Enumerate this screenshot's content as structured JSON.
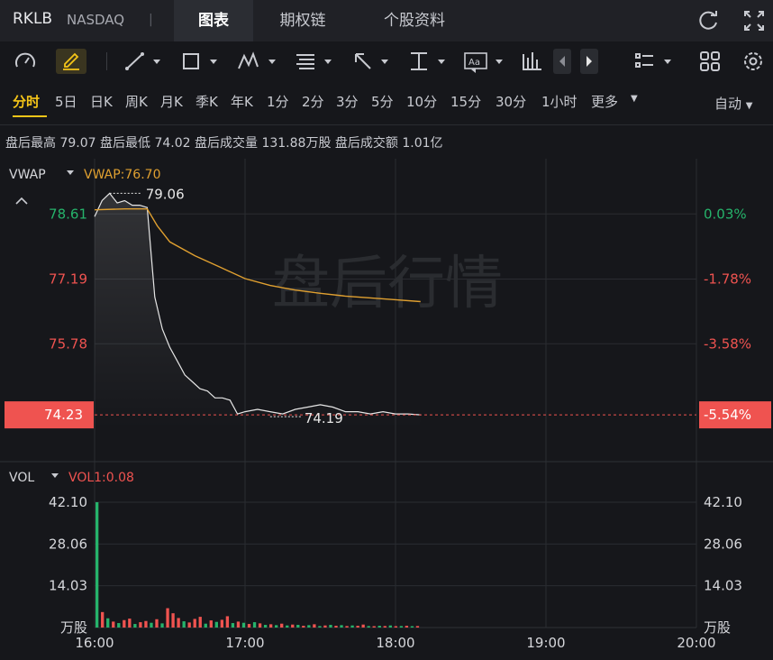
{
  "header": {
    "symbol": "RKLB",
    "exchange": "NASDAQ",
    "separator": "|",
    "tabs": [
      "图表",
      "期权链",
      "个股资料"
    ]
  },
  "periods": {
    "items": [
      "分时",
      "5日",
      "日K",
      "周K",
      "月K",
      "季K",
      "年K",
      "1分",
      "2分",
      "3分",
      "5分",
      "10分",
      "15分",
      "30分",
      "1小时",
      "更多"
    ],
    "selected": "分时",
    "auto_label": "自动"
  },
  "stats": {
    "high_label": "盘后最高",
    "high_value": "79.07",
    "low_label": "盘后最低",
    "low_value": "74.02",
    "vol_label": "盘后成交量",
    "vol_value": "131.88万股",
    "amt_label": "盘后成交额",
    "amt_value": "1.01亿"
  },
  "price_panel": {
    "indicator": "VWAP",
    "vwap_label": "VWAP:76.70",
    "watermark": "盘后行情",
    "left_axis": [
      "78.61",
      "77.19",
      "75.78"
    ],
    "right_axis": [
      "0.03%",
      "-1.78%",
      "-3.58%"
    ],
    "current_price": "74.23",
    "current_pct": "-5.54%",
    "high_annotation": "79.06",
    "low_annotation": "74.19"
  },
  "volume_panel": {
    "indicator": "VOL",
    "vol_label": "VOL1:0.08",
    "left_axis": [
      "42.10",
      "28.06",
      "14.03"
    ],
    "right_axis": [
      "42.10",
      "28.06",
      "14.03"
    ],
    "unit": "万股"
  },
  "time_axis": [
    "16:00",
    "17:00",
    "18:00",
    "19:00",
    "20:00"
  ],
  "colors": {
    "up": "#26b36b",
    "down": "#ef5350",
    "vwap": "#e0a030",
    "price_line": "#e6e6e6",
    "accent": "#f5c518"
  },
  "chart_data": {
    "type": "line",
    "x_range": [
      "16:00",
      "20:00"
    ],
    "price": {
      "x": [
        "16:00",
        "16:03",
        "16:06",
        "16:09",
        "16:12",
        "16:15",
        "16:18",
        "16:21",
        "16:24",
        "16:27",
        "16:30",
        "16:33",
        "16:36",
        "16:39",
        "16:42",
        "16:45",
        "16:48",
        "16:51",
        "16:54",
        "16:57",
        "17:00",
        "17:05",
        "17:10",
        "17:15",
        "17:20",
        "17:25",
        "17:30",
        "17:35",
        "17:40",
        "17:45",
        "17:50",
        "17:55",
        "18:00",
        "18:05",
        "18:10"
      ],
      "y": [
        78.55,
        78.9,
        79.06,
        78.85,
        78.9,
        78.8,
        78.8,
        78.75,
        76.8,
        76.1,
        75.7,
        75.4,
        75.1,
        74.95,
        74.8,
        74.75,
        74.6,
        74.6,
        74.55,
        74.25,
        74.3,
        74.35,
        74.3,
        74.25,
        74.35,
        74.4,
        74.45,
        74.4,
        74.3,
        74.3,
        74.25,
        74.3,
        74.25,
        74.25,
        74.23
      ]
    },
    "vwap": {
      "x": [
        "16:00",
        "16:12",
        "16:21",
        "16:25",
        "16:30",
        "16:40",
        "16:50",
        "17:00",
        "17:10",
        "17:20",
        "17:30",
        "17:40",
        "17:50",
        "18:00",
        "18:10"
      ],
      "y": [
        78.7,
        78.72,
        78.72,
        78.35,
        78.0,
        77.7,
        77.45,
        77.2,
        77.05,
        76.95,
        76.88,
        76.82,
        76.78,
        76.74,
        76.7
      ]
    },
    "volume": {
      "unit": "万股",
      "y_max": 42.1,
      "values": [
        42.1,
        5.2,
        3.1,
        2.0,
        1.5,
        2.5,
        3.0,
        1.2,
        1.8,
        2.2,
        1.6,
        2.8,
        1.4,
        6.5,
        4.8,
        3.2,
        2.1,
        1.7,
        2.9,
        3.6,
        1.3,
        2.4,
        1.9,
        2.6,
        3.8,
        1.5,
        2.0,
        1.6,
        1.2,
        1.8,
        1.4,
        0.9,
        1.1,
        0.8,
        1.3,
        0.7,
        1.0,
        0.9,
        0.6,
        0.8,
        1.1,
        0.5,
        0.7,
        0.9,
        0.6,
        0.8,
        0.5,
        0.7,
        0.6,
        1.0,
        0.5,
        0.4,
        0.6,
        0.5,
        0.7,
        0.4,
        0.5,
        0.6,
        0.4,
        0.5
      ],
      "up": [
        true,
        false,
        true,
        false,
        true,
        false,
        false,
        true,
        false,
        false,
        true,
        false,
        true,
        false,
        false,
        false,
        true,
        false,
        false,
        false,
        true,
        false,
        true,
        false,
        false,
        true,
        false,
        true,
        false,
        true,
        false,
        true,
        false,
        true,
        false,
        true,
        false,
        true,
        false,
        true,
        false,
        true,
        false,
        true,
        false,
        true,
        false,
        true,
        false,
        false,
        true,
        false,
        true,
        false,
        true,
        false,
        true,
        false,
        true,
        false
      ]
    },
    "y_range": [
      73.8,
      79.5
    ]
  }
}
